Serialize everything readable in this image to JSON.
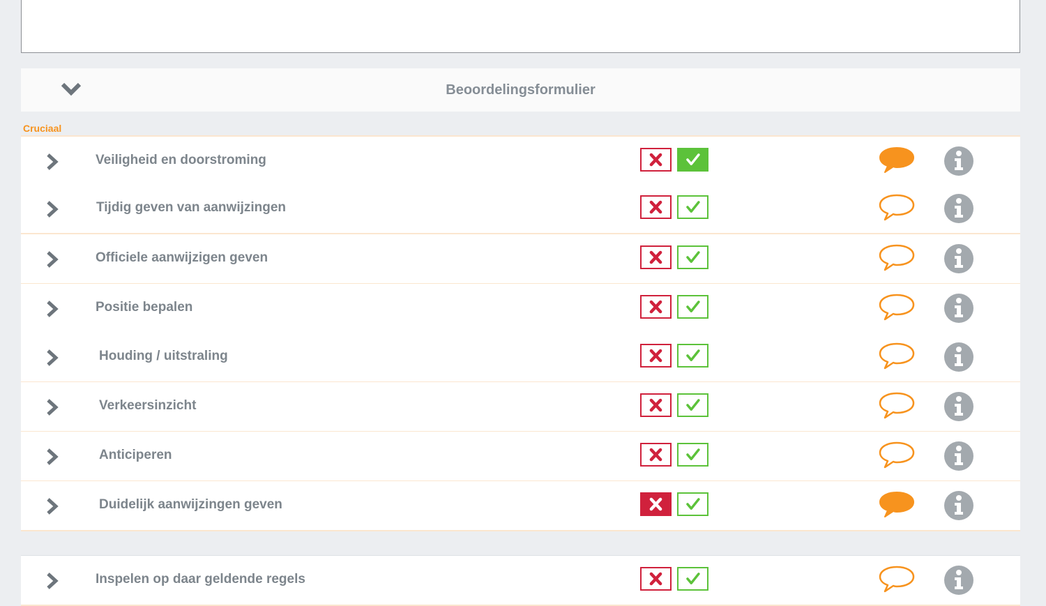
{
  "section": {
    "title": "Beoordelingsformulier"
  },
  "group": {
    "label": "Cruciaal"
  },
  "colors": {
    "accent_orange": "#f7931e",
    "fail_red": "#d0213c",
    "pass_green": "#5cc23a",
    "text_gray": "#7d858c",
    "info_gray": "#a3a9ae"
  },
  "items": [
    {
      "label": "Veiligheid en doorstroming",
      "fail_selected": false,
      "pass_selected": true,
      "has_comment": true
    },
    {
      "label": "Tijdig geven van aanwijzingen",
      "fail_selected": false,
      "pass_selected": false,
      "has_comment": false
    },
    {
      "label": "Officiele aanwijzigen geven",
      "fail_selected": false,
      "pass_selected": false,
      "has_comment": false
    },
    {
      "label": "Positie bepalen",
      "fail_selected": false,
      "pass_selected": false,
      "has_comment": false
    },
    {
      "label": "Houding / uitstraling",
      "fail_selected": false,
      "pass_selected": false,
      "has_comment": false
    },
    {
      "label": "Verkeersinzicht",
      "fail_selected": false,
      "pass_selected": false,
      "has_comment": false
    },
    {
      "label": "Anticiperen",
      "fail_selected": false,
      "pass_selected": false,
      "has_comment": false
    },
    {
      "label": "Duidelijk aanwijzingen geven",
      "fail_selected": true,
      "pass_selected": false,
      "has_comment": true
    },
    {
      "label": "Inspelen op daar geldende regels",
      "fail_selected": false,
      "pass_selected": false,
      "has_comment": false
    }
  ],
  "icons": {
    "collapse": "chevron-down-icon",
    "expand": "chevron-right-icon",
    "fail": "cross-icon",
    "pass": "checkmark-icon",
    "comment": "speech-bubble-icon",
    "info": "info-icon"
  }
}
